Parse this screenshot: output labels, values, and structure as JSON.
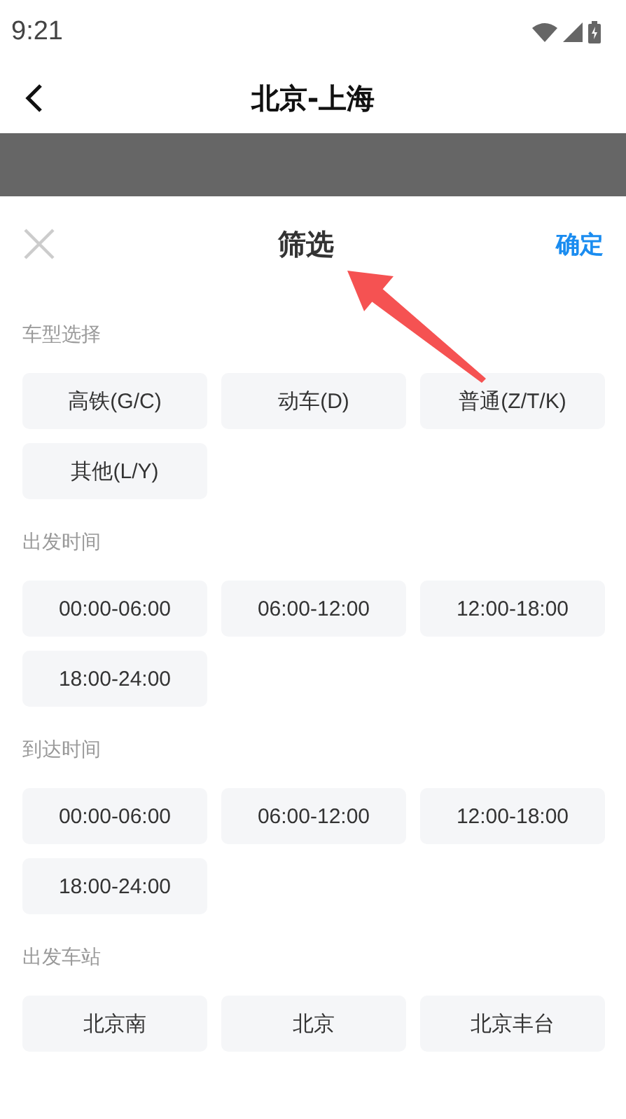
{
  "status_bar": {
    "time": "9:21"
  },
  "header": {
    "title": "北京-上海"
  },
  "sheet": {
    "title": "筛选",
    "confirm": "确定",
    "sections": [
      {
        "label": "车型选择",
        "options": [
          {
            "label": "高铁(G/C)",
            "selected": false
          },
          {
            "label": "动车(D)",
            "selected": false
          },
          {
            "label": "普通(Z/T/K)",
            "selected": false
          },
          {
            "label": "其他(L/Y)",
            "selected": false
          }
        ]
      },
      {
        "label": "出发时间",
        "options": [
          {
            "label": "00:00-06:00",
            "selected": false
          },
          {
            "label": "06:00-12:00",
            "selected": false
          },
          {
            "label": "12:00-18:00",
            "selected": false
          },
          {
            "label": "18:00-24:00",
            "selected": false
          }
        ]
      },
      {
        "label": "到达时间",
        "options": [
          {
            "label": "00:00-06:00",
            "selected": false
          },
          {
            "label": "06:00-12:00",
            "selected": false
          },
          {
            "label": "12:00-18:00",
            "selected": false
          },
          {
            "label": "18:00-24:00",
            "selected": false
          }
        ]
      },
      {
        "label": "出发车站",
        "options": [
          {
            "label": "北京南",
            "selected": false
          },
          {
            "label": "北京",
            "selected": false
          },
          {
            "label": "北京丰台",
            "selected": false
          }
        ]
      }
    ]
  }
}
